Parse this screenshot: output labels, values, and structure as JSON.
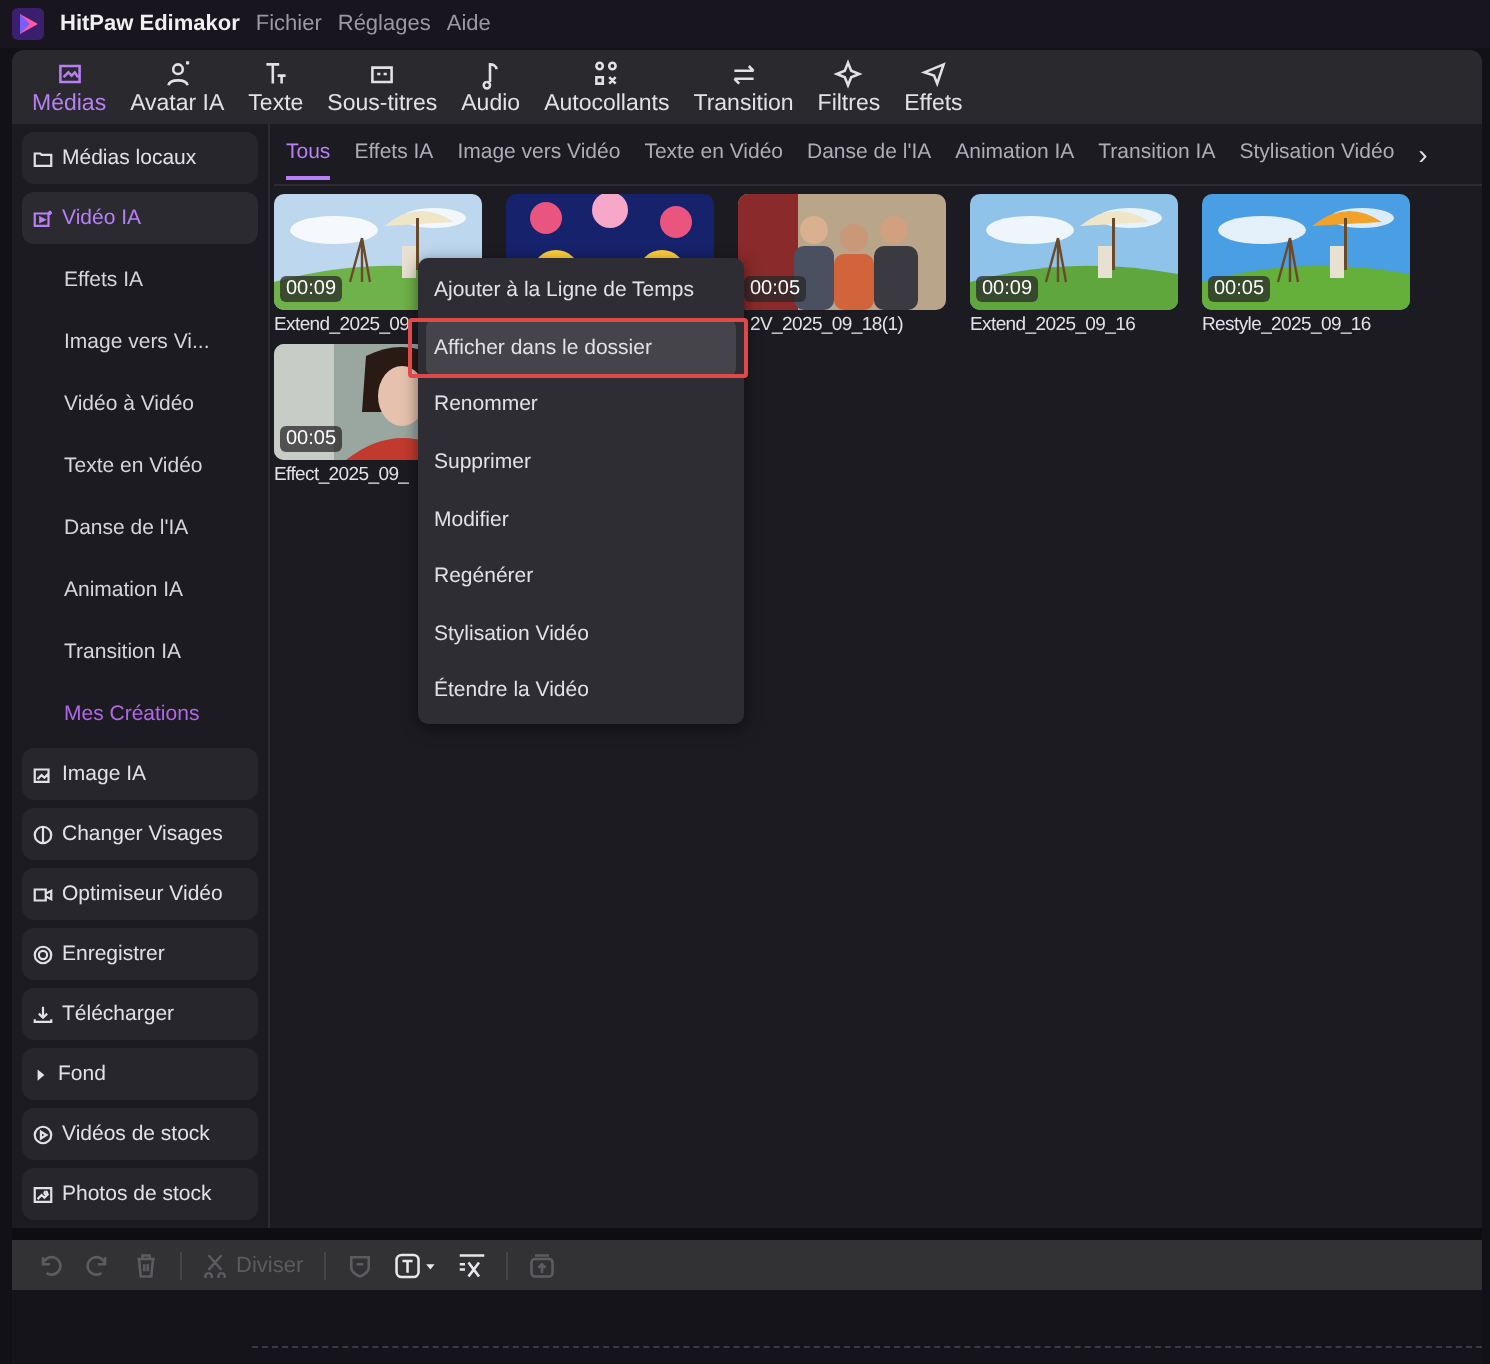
{
  "title_bar": {
    "app_name": "HitPaw Edimakor",
    "menus": [
      "Fichier",
      "Réglages",
      "Aide"
    ]
  },
  "toolbar": [
    {
      "label": "Médias",
      "selected": true
    },
    {
      "label": "Avatar IA",
      "selected": false
    },
    {
      "label": "Texte",
      "selected": false
    },
    {
      "label": "Sous-titres",
      "selected": false
    },
    {
      "label": "Audio",
      "selected": false
    },
    {
      "label": "Autocollants",
      "selected": false
    },
    {
      "label": "Transition",
      "selected": false
    },
    {
      "label": "Filtres",
      "selected": false
    },
    {
      "label": "Effets",
      "selected": false
    }
  ],
  "sidebar": {
    "items": [
      {
        "label": "Médias locaux",
        "selected": false
      },
      {
        "label": "Vidéo IA",
        "selected": true,
        "expanded": true,
        "children": [
          {
            "label": "Effets IA",
            "selected": false
          },
          {
            "label": "Image vers Vi...",
            "selected": false
          },
          {
            "label": "Vidéo à Vidéo",
            "selected": false
          },
          {
            "label": "Texte en Vidéo",
            "selected": false
          },
          {
            "label": "Danse de l'IA",
            "selected": false
          },
          {
            "label": "Animation IA",
            "selected": false
          },
          {
            "label": "Transition IA",
            "selected": false
          },
          {
            "label": "Mes Créations",
            "selected": true
          }
        ]
      },
      {
        "label": "Image IA",
        "selected": false
      },
      {
        "label": "Changer Visages",
        "selected": false
      },
      {
        "label": "Optimiseur Vidéo",
        "selected": false
      },
      {
        "label": "Enregistrer",
        "selected": false
      },
      {
        "label": "Télécharger",
        "selected": false
      },
      {
        "label": "Fond",
        "selected": false,
        "expanded": false
      },
      {
        "label": "Vidéos de stock",
        "selected": false
      },
      {
        "label": "Photos de stock",
        "selected": false
      }
    ]
  },
  "tabs": [
    {
      "label": "Tous",
      "selected": true
    },
    {
      "label": "Effets IA",
      "selected": false
    },
    {
      "label": "Image vers Vidéo",
      "selected": false
    },
    {
      "label": "Texte en Vidéo",
      "selected": false
    },
    {
      "label": "Danse de l'IA",
      "selected": false
    },
    {
      "label": "Animation IA",
      "selected": false
    },
    {
      "label": "Transition IA",
      "selected": false
    },
    {
      "label": "Stylisation Vidéo",
      "selected": false
    }
  ],
  "tabs_more": "›",
  "media": [
    {
      "kind": "picture",
      "duration": "00:09",
      "name": "Extend_2025_09"
    },
    {
      "kind": "picture"
    },
    {
      "kind": "picture",
      "duration": "00:05",
      "name": "2V_2025_09_18(1)"
    },
    {
      "kind": "picture",
      "duration": "00:09",
      "name": "Extend_2025_09_16"
    },
    {
      "kind": "picture",
      "duration": "00:05",
      "name": "Restyle_2025_09_16"
    },
    {
      "kind": "picture",
      "duration": "00:05",
      "name": "Effect_2025_09_"
    }
  ],
  "context_menu": [
    {
      "label": "Ajouter à la Ligne de Temps",
      "highlighted": false
    },
    {
      "label": "Afficher dans le dossier",
      "highlighted": true
    },
    {
      "label": "Renommer",
      "highlighted": false
    },
    {
      "label": "Supprimer",
      "highlighted": false
    },
    {
      "label": "Modifier",
      "highlighted": false
    },
    {
      "label": "Regénérer",
      "highlighted": false
    },
    {
      "label": "Stylisation Vidéo",
      "highlighted": false
    },
    {
      "label": "Étendre la Vidéo",
      "highlighted": false
    }
  ],
  "timeline_toolbar": {
    "split": {
      "label": "Diviser",
      "disabled": true
    }
  }
}
